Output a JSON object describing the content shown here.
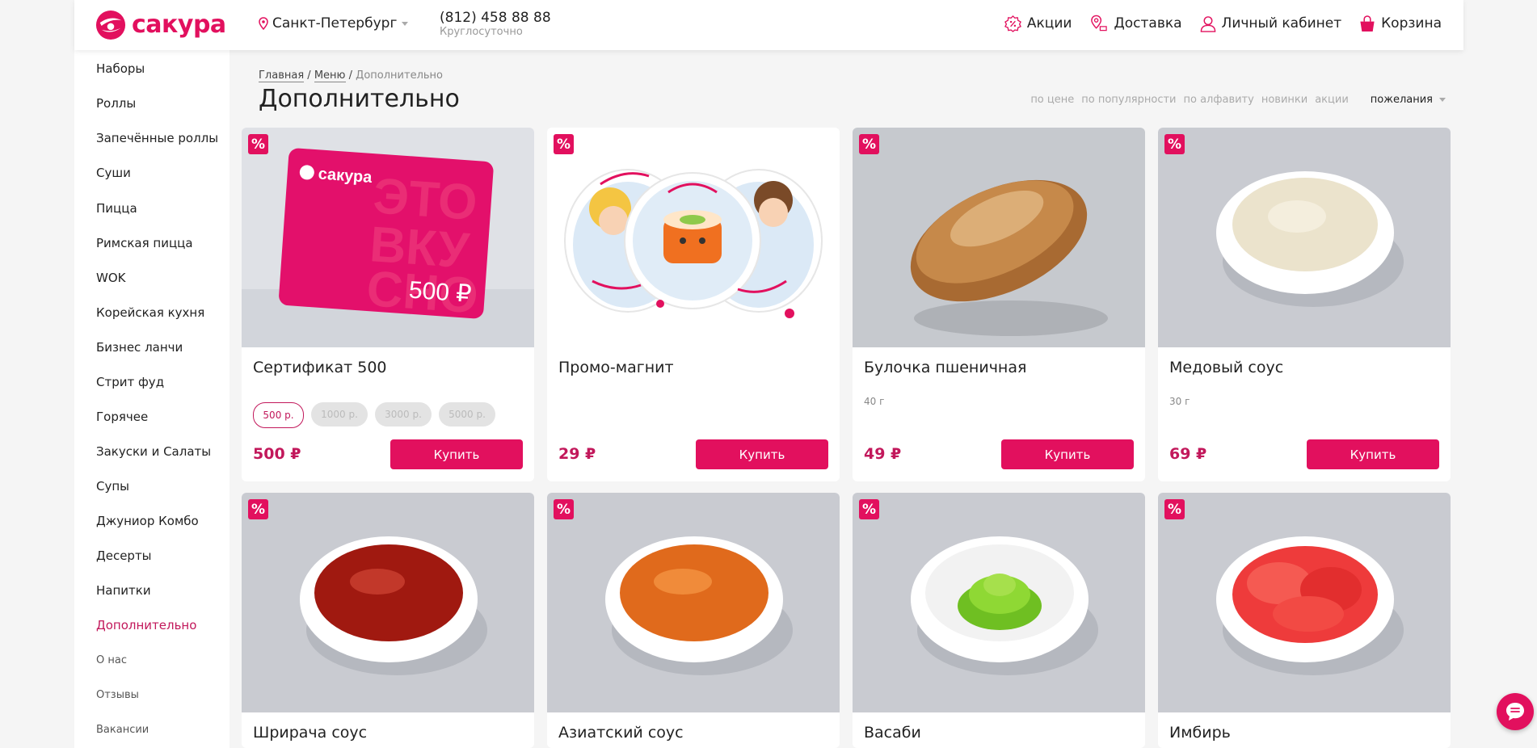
{
  "header": {
    "logo_text": "сакура",
    "city": "Санкт-Петербург",
    "phone": "(812) 458 88 88",
    "hours": "Круглосуточно",
    "nav": [
      {
        "label": "Акции",
        "icon": "percent-badge-icon"
      },
      {
        "label": "Доставка",
        "icon": "map-pin-icon"
      },
      {
        "label": "Личный кабинет",
        "icon": "user-icon"
      },
      {
        "label": "Корзина",
        "icon": "basket-icon"
      }
    ]
  },
  "sidebar": {
    "categories": [
      "Наборы",
      "Роллы",
      "Запечённые роллы",
      "Суши",
      "Пицца",
      "Римская пицца",
      "WOK",
      "Корейская кухня",
      "Бизнес ланчи",
      "Стрит фуд",
      "Горячее",
      "Закуски и Салаты",
      "Супы",
      "Джуниор Комбо",
      "Десерты",
      "Напитки",
      "Дополнительно"
    ],
    "active": "Дополнительно",
    "links": [
      "О нас",
      "Отзывы",
      "Вакансии"
    ]
  },
  "breadcrumb": {
    "home": "Главная",
    "sep": "/",
    "menu": "Меню",
    "current": "Дополнительно"
  },
  "page_title": "Дополнительно",
  "sort": {
    "options": [
      "по цене",
      "по популярности",
      "по алфавиту",
      "новинки",
      "акции"
    ],
    "selected": "пожелания"
  },
  "badge": "%",
  "buy_label": "Купить",
  "products": [
    {
      "name": "Сертификат 500",
      "price": "500 ₽",
      "options": [
        "500 р.",
        "1000 р.",
        "3000 р.",
        "5000 р."
      ],
      "selected_option": "500 р.",
      "card_text": "сакура",
      "card_value": "500 ₽"
    },
    {
      "name": "Промо-магнит",
      "price": "29 ₽"
    },
    {
      "name": "Булочка пшеничная",
      "weight": "40 г",
      "price": "49 ₽"
    },
    {
      "name": "Медовый соус",
      "weight": "30 г",
      "price": "69 ₽"
    },
    {
      "name": "Шрирача соус"
    },
    {
      "name": "Азиатский соус"
    },
    {
      "name": "Васаби"
    },
    {
      "name": "Имбирь"
    }
  ],
  "colors": {
    "brand": "#e2105e",
    "active_text": "#c2185b",
    "background": "#f5f5f5"
  }
}
